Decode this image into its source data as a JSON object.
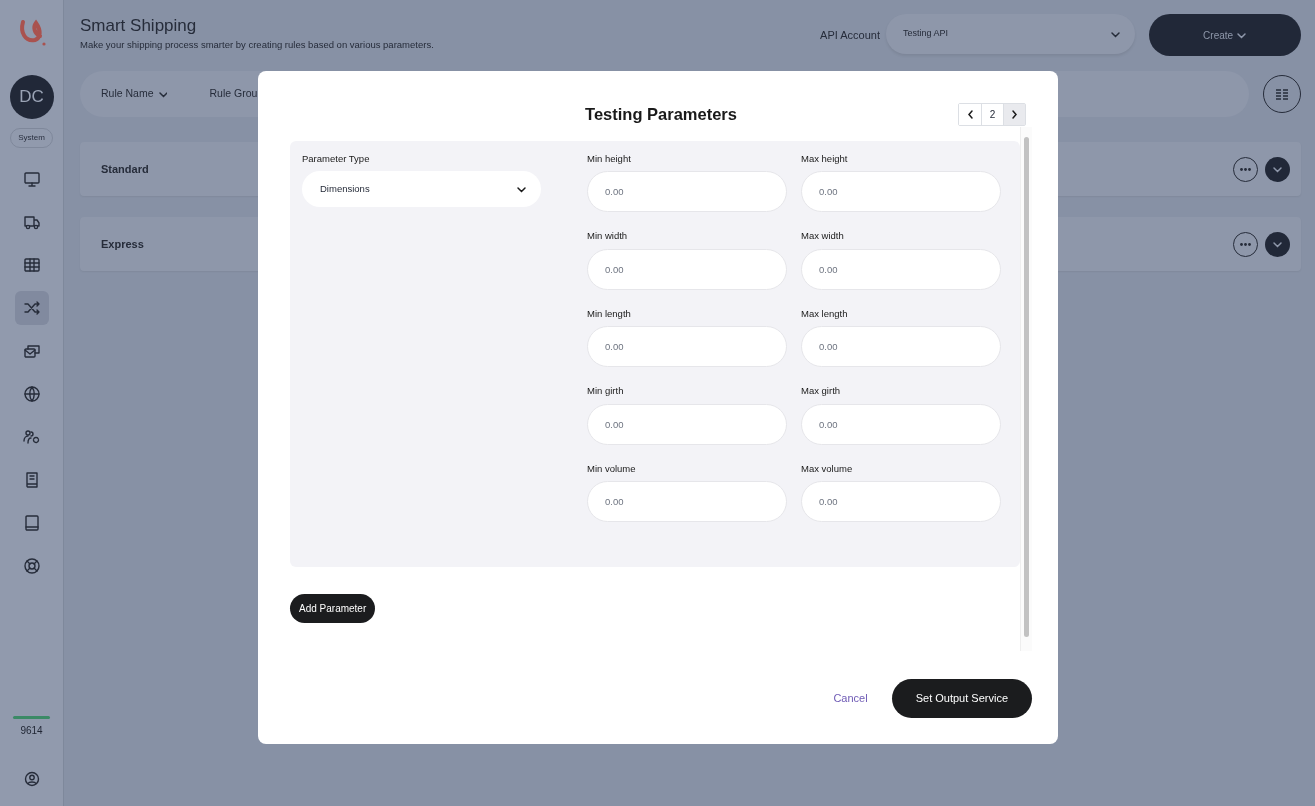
{
  "sidebar": {
    "avatar": "DC",
    "role": "System",
    "nav_items": [
      {
        "selected": false
      },
      {
        "selected": false
      },
      {
        "selected": false
      },
      {
        "selected": true
      },
      {
        "selected": false
      },
      {
        "selected": false
      },
      {
        "selected": false
      },
      {
        "selected": false
      },
      {
        "selected": false
      },
      {
        "selected": false
      }
    ],
    "balance": "9614"
  },
  "header": {
    "title": "Smart Shipping",
    "subtitle": "Make your shipping process smarter by creating rules based on various parameters.",
    "api_account_label": "API Account",
    "api_account": "Testing API",
    "create_button": "Create"
  },
  "filters": [
    {
      "label": "Rule Name"
    },
    {
      "label": "Rule Grou"
    }
  ],
  "rule_groups": [
    {
      "name": "Standard"
    },
    {
      "name": "Express"
    }
  ],
  "modal": {
    "title": "Testing Parameters",
    "pager": {
      "page": "2"
    },
    "parameter_type_label": "Parameter Type",
    "parameter_type": "Dimensions",
    "fields": [
      {
        "label": "Min height",
        "placeholder": "0.00"
      },
      {
        "label": "Max height",
        "placeholder": "0.00"
      },
      {
        "label": "Min width",
        "placeholder": "0.00"
      },
      {
        "label": "Max width",
        "placeholder": "0.00"
      },
      {
        "label": "Min length",
        "placeholder": "0.00"
      },
      {
        "label": "Max length",
        "placeholder": "0.00"
      },
      {
        "label": "Min girth",
        "placeholder": "0.00"
      },
      {
        "label": "Max girth",
        "placeholder": "0.00"
      },
      {
        "label": "Min volume",
        "placeholder": "0.00"
      },
      {
        "label": "Max volume",
        "placeholder": "0.00"
      }
    ],
    "add_button": "Add Parameter",
    "cancel": "Cancel",
    "submit": "Set Output Service"
  }
}
